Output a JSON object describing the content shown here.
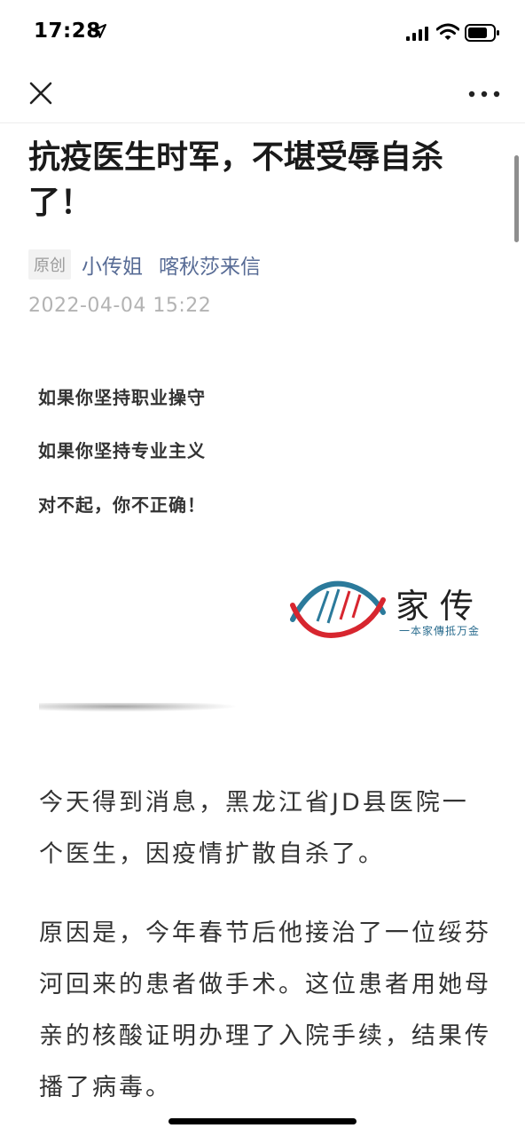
{
  "status_bar": {
    "time": "17:28",
    "icons": [
      "location-arrow-icon",
      "cellular-signal-icon",
      "wifi-icon",
      "battery-icon"
    ]
  },
  "nav": {
    "close_icon": "close-icon",
    "more_icon": "more-dots-icon"
  },
  "article": {
    "title": "抗疫医生时军，不堪受辱自杀了！",
    "badge": "原创",
    "author": "小传姐",
    "account": "喀秋莎来信",
    "date": "2022-04-04 15:22",
    "intro": [
      "如果你坚持职业操守",
      "如果你坚持专业主义",
      "对不起，你不正确！"
    ],
    "logo": {
      "name": "家传",
      "slogan": "一本家傳抵万金",
      "colors": {
        "red": "#d7262f",
        "teal": "#2b7a9b"
      }
    },
    "paragraphs": [
      "今天得到消息，黑龙江省JD县医院一个医生，因疫情扩散自杀了。",
      "原因是，今年春节后他接治了一位绥芬河回来的患者做手术。这位患者用她母亲的核酸证明办理了入院手续，结果传播了病毒。"
    ]
  },
  "colors": {
    "link": "#576b95",
    "meta_gray": "#b3b3b3",
    "text": "#333333"
  }
}
